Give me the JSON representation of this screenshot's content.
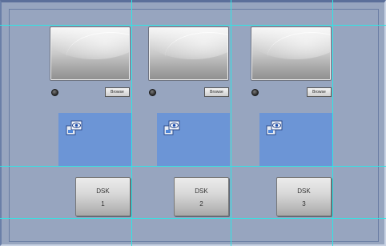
{
  "channels": [
    {
      "browse_label": "Browse",
      "dsk_label": "DSK",
      "dsk_number": "1"
    },
    {
      "browse_label": "Browse",
      "dsk_label": "DSK",
      "dsk_number": "2"
    },
    {
      "browse_label": "Browse",
      "dsk_label": "DSK",
      "dsk_number": "3"
    }
  ],
  "colors": {
    "background": "#97a5bf",
    "guide_lines": "#2ee6e6",
    "panel_blue": "#6c95d6"
  },
  "icons": [
    "preview-icon",
    "status-led-icon"
  ]
}
